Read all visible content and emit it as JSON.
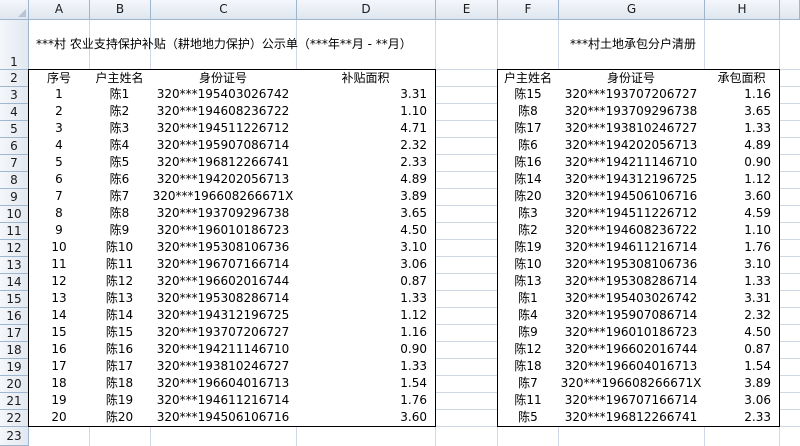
{
  "columns": [
    "A",
    "B",
    "C",
    "D",
    "E",
    "F",
    "G",
    "H"
  ],
  "rows": [
    "1",
    "2",
    "3",
    "4",
    "5",
    "6",
    "7",
    "8",
    "9",
    "10",
    "11",
    "12",
    "13",
    "14",
    "15",
    "16",
    "17",
    "18",
    "19",
    "20",
    "21",
    "22",
    "23"
  ],
  "title_left": "***村 农业支持保护补贴（耕地地力保护）公示单（***年**月 - **月）",
  "title_right": "***村土地承包分户清册",
  "left_headers": [
    "序号",
    "户主姓名",
    "身份证号",
    "补贴面积"
  ],
  "right_headers": [
    "户主姓名",
    "身份证号",
    "承包面积"
  ],
  "left_rows": [
    [
      "1",
      "陈1",
      "320***195403026742",
      "3.31"
    ],
    [
      "2",
      "陈2",
      "320***194608236722",
      "1.10"
    ],
    [
      "3",
      "陈3",
      "320***194511226712",
      "4.71"
    ],
    [
      "4",
      "陈4",
      "320***195907086714",
      "2.32"
    ],
    [
      "5",
      "陈5",
      "320***196812266741",
      "2.33"
    ],
    [
      "6",
      "陈6",
      "320***194202056713",
      "4.89"
    ],
    [
      "7",
      "陈7",
      "320***196608266671X",
      "3.89"
    ],
    [
      "8",
      "陈8",
      "320***193709296738",
      "3.65"
    ],
    [
      "9",
      "陈9",
      "320***196010186723",
      "4.50"
    ],
    [
      "10",
      "陈10",
      "320***195308106736",
      "3.10"
    ],
    [
      "11",
      "陈11",
      "320***196707166714",
      "3.06"
    ],
    [
      "12",
      "陈12",
      "320***196602016744",
      "0.87"
    ],
    [
      "13",
      "陈13",
      "320***195308286714",
      "1.33"
    ],
    [
      "14",
      "陈14",
      "320***194312196725",
      "1.12"
    ],
    [
      "15",
      "陈15",
      "320***193707206727",
      "1.16"
    ],
    [
      "16",
      "陈16",
      "320***194211146710",
      "0.90"
    ],
    [
      "17",
      "陈17",
      "320***193810246727",
      "1.33"
    ],
    [
      "18",
      "陈18",
      "320***196604016713",
      "1.54"
    ],
    [
      "19",
      "陈19",
      "320***194611216714",
      "1.76"
    ],
    [
      "20",
      "陈20",
      "320***194506106716",
      "3.60"
    ]
  ],
  "right_rows": [
    [
      "陈15",
      "320***193707206727",
      "1.16"
    ],
    [
      "陈8",
      "320***193709296738",
      "3.65"
    ],
    [
      "陈17",
      "320***193810246727",
      "1.33"
    ],
    [
      "陈6",
      "320***194202056713",
      "4.89"
    ],
    [
      "陈16",
      "320***194211146710",
      "0.90"
    ],
    [
      "陈14",
      "320***194312196725",
      "1.12"
    ],
    [
      "陈20",
      "320***194506106716",
      "3.60"
    ],
    [
      "陈3",
      "320***194511226712",
      "4.59"
    ],
    [
      "陈2",
      "320***194608236722",
      "1.10"
    ],
    [
      "陈19",
      "320***194611216714",
      "1.76"
    ],
    [
      "陈10",
      "320***195308106736",
      "3.10"
    ],
    [
      "陈13",
      "320***195308286714",
      "1.33"
    ],
    [
      "陈1",
      "320***195403026742",
      "3.31"
    ],
    [
      "陈4",
      "320***195907086714",
      "2.32"
    ],
    [
      "陈9",
      "320***196010186723",
      "4.50"
    ],
    [
      "陈12",
      "320***196602016744",
      "0.87"
    ],
    [
      "陈18",
      "320***196604016713",
      "1.54"
    ],
    [
      "陈7",
      "320***196608266671X",
      "3.89"
    ],
    [
      "陈11",
      "320***196707166714",
      "3.06"
    ],
    [
      "陈5",
      "320***196812266741",
      "2.33"
    ]
  ],
  "colors": {
    "header_bg": "#e4ecf7",
    "grid": "#d0d7e5",
    "header_border": "#9eb6ce"
  }
}
